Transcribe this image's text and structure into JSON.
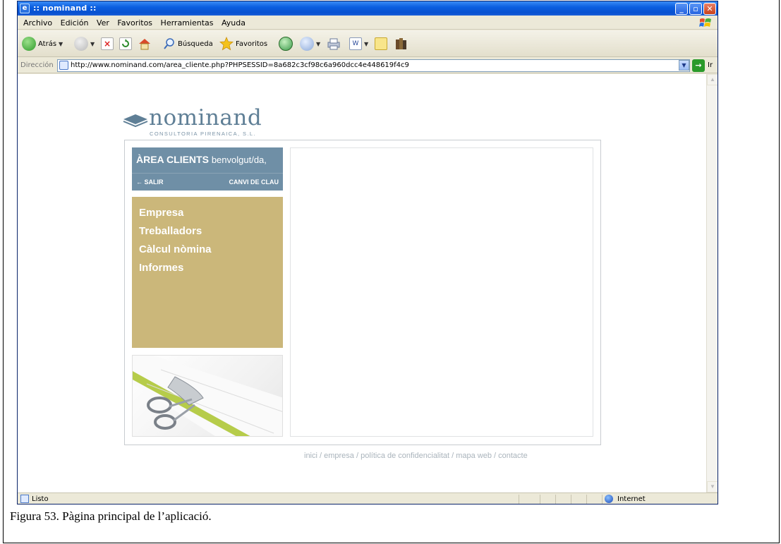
{
  "window": {
    "title": ":: nominand ::",
    "controls": {
      "minimize": "_",
      "maximize": "▫",
      "close": "✕"
    }
  },
  "menubar": {
    "items": [
      "Archivo",
      "Edición",
      "Ver",
      "Favoritos",
      "Herramientas",
      "Ayuda"
    ]
  },
  "toolbar": {
    "back_label": "Atrás",
    "search_label": "Búsqueda",
    "favorites_label": "Favoritos"
  },
  "address": {
    "label": "Dirección",
    "url": "http://www.nominand.com/area_cliente.php?PHPSESSID=8a682c3cf98c6a960dcc4e448619f4c9",
    "go_label": "Ir"
  },
  "page": {
    "logo": {
      "word": "nominand",
      "subtitle": "CONSULTORIA PIRENAICA, S.L."
    },
    "client_area": {
      "title": "ÀREA CLIENTS",
      "greeting": "benvolgut/da,",
      "logout": "← SALIR",
      "change_key": "CANVI DE CLAU"
    },
    "menu": [
      "Empresa",
      "Treballadors",
      "Càlcul nòmina",
      "Informes"
    ],
    "footer_links": "inici / empresa / política de confidencialitat / mapa web / contacte"
  },
  "statusbar": {
    "status": "Listo",
    "zone": "Internet"
  },
  "caption": "Figura 53. Pàgina principal de l’aplicació.",
  "colors": {
    "titlebar": "#0b5fe0",
    "client_header": "#6f8fa6",
    "menu_panel": "#cbb77a",
    "logo_text": "#5f7f96"
  }
}
